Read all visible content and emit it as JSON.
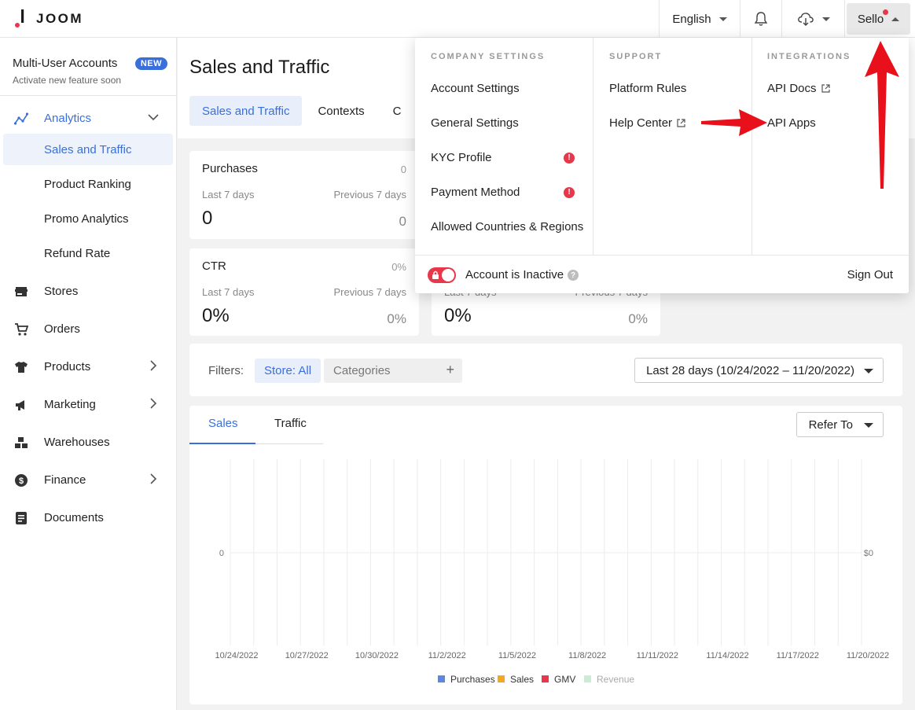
{
  "topbar": {
    "logo_text": "JOOM",
    "language": "English",
    "user_name": "Sello"
  },
  "sidebar": {
    "promo_title": "Multi-User Accounts",
    "promo_subtitle": "Activate new feature soon",
    "promo_badge": "NEW",
    "items": [
      {
        "label": "Analytics"
      },
      {
        "label": "Sales and Traffic"
      },
      {
        "label": "Product Ranking"
      },
      {
        "label": "Promo Analytics"
      },
      {
        "label": "Refund Rate"
      },
      {
        "label": "Stores"
      },
      {
        "label": "Orders"
      },
      {
        "label": "Products"
      },
      {
        "label": "Marketing"
      },
      {
        "label": "Warehouses"
      },
      {
        "label": "Finance"
      },
      {
        "label": "Documents"
      }
    ]
  },
  "main": {
    "title": "Sales and Traffic",
    "tabs": [
      "Sales and Traffic",
      "Contexts",
      "C"
    ],
    "kpis": [
      {
        "title": "Purchases",
        "total": "0",
        "last_label": "Last 7 days",
        "prev_label": "Previous 7 days",
        "value": "0",
        "prev_value": "0"
      },
      {
        "title": "CTR",
        "total": "0%",
        "last_label": "Last 7 days",
        "prev_label": "Previous 7 days",
        "value": "0%",
        "prev_value": "0%"
      },
      {
        "title": "",
        "total": "",
        "last_label": "Last 7 days",
        "prev_label": "Previous 7 days",
        "value": "0%",
        "prev_value": "0%"
      }
    ],
    "filters": {
      "label": "Filters:",
      "store_chip": "Store: All",
      "categories_chip": "Categories",
      "date_range": "Last 28 days (10/24/2022 – 11/20/2022)"
    },
    "chart_tabs": [
      "Sales",
      "Traffic"
    ],
    "refer_to": "Refer To"
  },
  "chart_data": {
    "type": "line",
    "x": [
      "10/24/2022",
      "10/27/2022",
      "10/30/2022",
      "11/2/2022",
      "11/5/2022",
      "11/8/2022",
      "11/11/2022",
      "11/14/2022",
      "11/17/2022",
      "11/20/2022"
    ],
    "series": [
      {
        "name": "Purchases",
        "values": [],
        "color": "#5b86e5"
      },
      {
        "name": "Sales",
        "values": [],
        "color": "#f5a623"
      },
      {
        "name": "GMV",
        "values": [],
        "color": "#e8364a"
      },
      {
        "name": "Revenue",
        "values": [],
        "color": "#c8ecd6",
        "disabled": true
      }
    ],
    "y_left_tick": "0",
    "y_right_tick": "$0",
    "legend_position": "bottom"
  },
  "dropdown": {
    "company_head": "COMPANY SETTINGS",
    "company_items": [
      "Account Settings",
      "General Settings",
      "KYC Profile",
      "Payment Method",
      "Allowed Countries & Regions"
    ],
    "support_head": "SUPPORT",
    "support_items": [
      "Platform Rules",
      "Help Center"
    ],
    "integrations_head": "INTEGRATIONS",
    "integrations_items": [
      "API Docs",
      "API Apps"
    ],
    "account_status": "Account is Inactive",
    "sign_out": "Sign Out"
  },
  "colors": {
    "accent": "#3a6fdb",
    "alert": "#e8364a",
    "annotation_arrow": "#e8101a"
  }
}
